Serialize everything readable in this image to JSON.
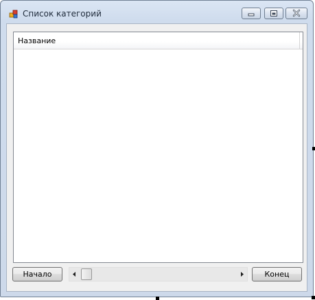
{
  "window": {
    "title": "Список категорий",
    "icon": "app-categories-icon",
    "controls": {
      "minimize": "minimize-icon",
      "maximize": "maximize-icon",
      "close": "close-icon"
    }
  },
  "listview": {
    "columns": [
      {
        "label": "Название"
      }
    ],
    "rows": []
  },
  "navigation": {
    "start_label": "Начало",
    "end_label": "Конец",
    "scroll_position": 0
  },
  "colors": {
    "title_text": "#1e2a3a",
    "frame": "#cfdced",
    "client_bg": "#f0f0f0"
  }
}
